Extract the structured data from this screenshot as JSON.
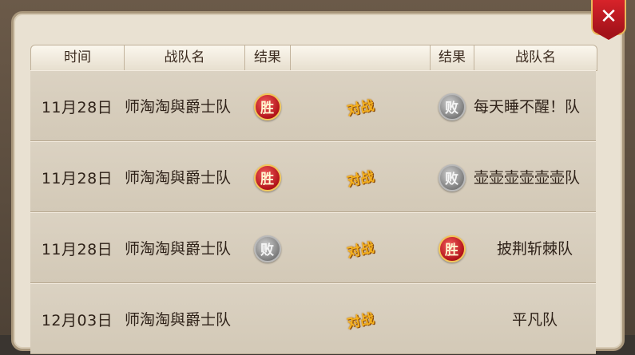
{
  "header": {
    "time": "时间",
    "team": "战队名",
    "result": "结果",
    "vs": "",
    "result2": "结果",
    "team2": "战队名"
  },
  "close_label": "✕",
  "rows": [
    {
      "date": "11月28日",
      "team1": "师淘淘與爵士队",
      "result1": "胜",
      "result1_type": "win",
      "vs": "对战",
      "result2": "败",
      "result2_type": "lose",
      "team2": "每天睡不醒！队"
    },
    {
      "date": "11月28日",
      "team1": "师淘淘與爵士队",
      "result1": "胜",
      "result1_type": "win",
      "vs": "对战",
      "result2": "败",
      "result2_type": "lose",
      "team2": "壶壶壶壶壶壶队"
    },
    {
      "date": "11月28日",
      "team1": "师淘淘與爵士队",
      "result1": "败",
      "result1_type": "lose",
      "vs": "对战",
      "result2": "胜",
      "result2_type": "win",
      "team2": "披荆斩棘队"
    },
    {
      "date": "12月03日",
      "team1": "师淘淘與爵士队",
      "result1": "",
      "result1_type": "",
      "vs": "对战",
      "result2": "",
      "result2_type": "",
      "team2": "平凡队"
    }
  ]
}
